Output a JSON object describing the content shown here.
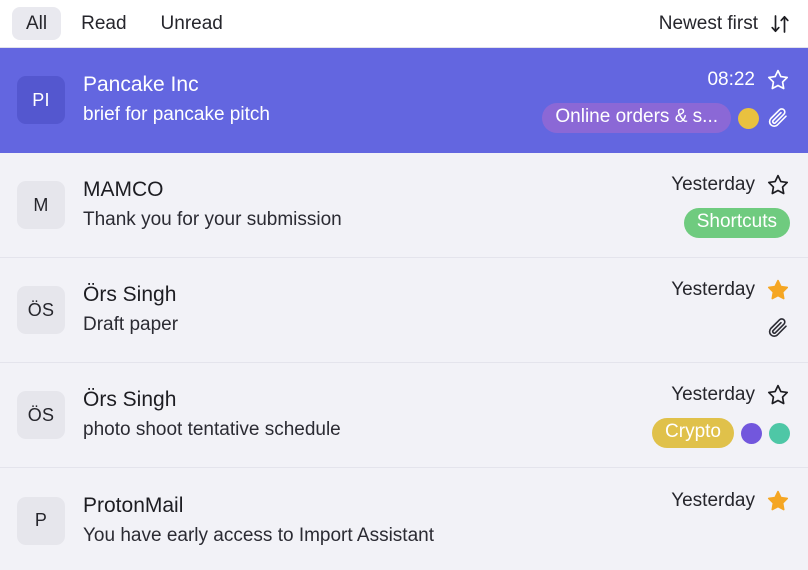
{
  "toolbar": {
    "filters": [
      {
        "label": "All",
        "active": true
      },
      {
        "label": "Read",
        "active": false
      },
      {
        "label": "Unread",
        "active": false
      }
    ],
    "sort_label": "Newest first",
    "sort_icon": "sort-down-up-icon"
  },
  "colors": {
    "selected_row_bg": "#6366e0",
    "row_bg": "#f2f2f7",
    "header_bg": "#ffffff",
    "avatar_bg": "#e6e6ec",
    "avatar_bg_selected": "#5457cf",
    "star_filled": "#f5a623",
    "chip_green": "#6fcb7f",
    "chip_yellow": "#e0c14a",
    "chip_on_selected": "#8b68d6",
    "dot_yellow": "#e9c13f",
    "dot_purple": "#7257dd",
    "dot_teal": "#4ec7a6"
  },
  "emails": [
    {
      "avatar_initials": "PI",
      "sender": "Pancake Inc",
      "subject": "brief for pancake pitch",
      "date": "08:22",
      "starred": false,
      "selected": true,
      "has_attachment": true,
      "label": {
        "text": "Online orders & s...",
        "color": "#8b68d6"
      },
      "dots": [
        {
          "color": "#e9c13f"
        }
      ]
    },
    {
      "avatar_initials": "M",
      "sender": "MAMCO",
      "subject": "Thank you for your submission",
      "date": "Yesterday",
      "starred": false,
      "selected": false,
      "has_attachment": false,
      "label": {
        "text": "Shortcuts",
        "color": "#6fcb7f"
      },
      "dots": []
    },
    {
      "avatar_initials": "ÖS",
      "sender": "Örs Singh",
      "subject": "Draft paper",
      "date": "Yesterday",
      "starred": true,
      "selected": false,
      "has_attachment": true,
      "label": null,
      "dots": []
    },
    {
      "avatar_initials": "ÖS",
      "sender": "Örs Singh",
      "subject": "photo shoot tentative schedule",
      "date": "Yesterday",
      "starred": false,
      "selected": false,
      "has_attachment": false,
      "label": {
        "text": "Crypto",
        "color": "#e0c14a"
      },
      "dots": [
        {
          "color": "#7257dd"
        },
        {
          "color": "#4ec7a6"
        }
      ]
    },
    {
      "avatar_initials": "P",
      "sender": "ProtonMail",
      "subject": "You have early access to Import Assistant",
      "date": "Yesterday",
      "starred": true,
      "selected": false,
      "has_attachment": false,
      "label": null,
      "dots": []
    }
  ]
}
